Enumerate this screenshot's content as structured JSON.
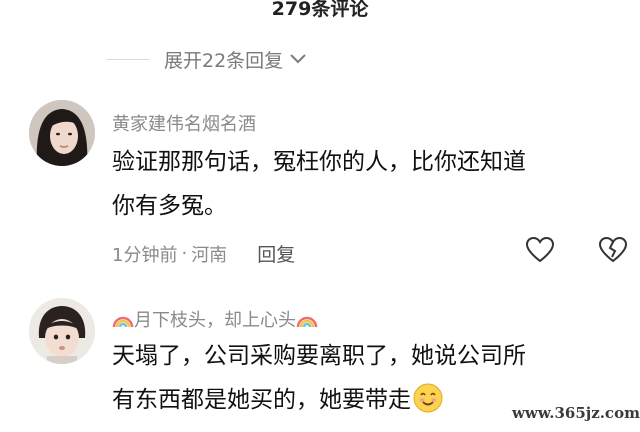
{
  "header": {
    "title": "279条评论"
  },
  "expand": {
    "label": "展开22条回复"
  },
  "comments": [
    {
      "username": "黄家建伟名烟名酒",
      "text_lines": [
        "验证那那句话，冤枉你的人，比你还知道",
        "你有多冤。"
      ],
      "time": "1分钟前",
      "separator": "·",
      "location": "河南",
      "reply_label": "回复"
    },
    {
      "username": "月下枝头，却上心头",
      "text_lines": [
        "天塌了，公司采购要离职了，她说公司所",
        "有东西都是她买的，她要带走"
      ]
    }
  ],
  "icons": {
    "expand": "chevron-down-icon",
    "like": "heart-icon",
    "dislike": "broken-heart-icon",
    "username_prefix": "rainbow-icon",
    "username_suffix": "rainbow-icon",
    "emoji": "blushing-smile-emoji"
  },
  "watermark": "www.365jz.com"
}
